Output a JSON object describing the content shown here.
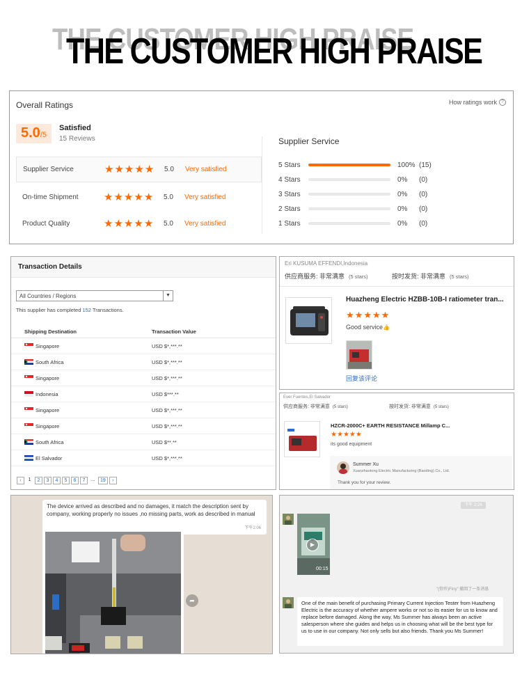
{
  "header": {
    "title": "THE CUSTOMER HIGH PRAISE"
  },
  "ratings": {
    "title": "Overall Ratings",
    "how_link": "How ratings work",
    "score": "5.0",
    "score_max": "/5",
    "level": "Satisfied",
    "reviews": "15 Reviews",
    "rows": [
      {
        "label": "Supplier Service",
        "stars": 5,
        "value": "5.0",
        "verdict": "Very satisfied"
      },
      {
        "label": "On-time Shipment",
        "stars": 5,
        "value": "5.0",
        "verdict": "Very satisfied"
      },
      {
        "label": "Product Quality",
        "stars": 5,
        "value": "5.0",
        "verdict": "Very satisfied"
      }
    ],
    "distribution_title": "Supplier Service",
    "distribution": [
      {
        "label": "5 Stars",
        "fraction": 1.0,
        "pct": "100%",
        "count": "(15)"
      },
      {
        "label": "4 Stars",
        "fraction": 0,
        "pct": "0%",
        "count": "(0)"
      },
      {
        "label": "3 Stars",
        "fraction": 0,
        "pct": "0%",
        "count": "(0)"
      },
      {
        "label": "2 Stars",
        "fraction": 0,
        "pct": "0%",
        "count": "(0)"
      },
      {
        "label": "1 Stars",
        "fraction": 0,
        "pct": "0%",
        "count": "(0)"
      }
    ],
    "accent": "#ff6a00"
  },
  "transactions": {
    "title": "Transaction Details",
    "select_value": "All Countries / Regions",
    "note_prefix": "This supplier has completed ",
    "note_count": "152",
    "note_suffix": " Transactions.",
    "col_destination": "Shipping Destination",
    "col_value": "Transaction Value",
    "rows": [
      {
        "country": "Singapore",
        "flag": "sg",
        "amount": "USD $*,***.**"
      },
      {
        "country": "South Africa",
        "flag": "za",
        "amount": "USD $*,***.**"
      },
      {
        "country": "Singapore",
        "flag": "sg",
        "amount": "USD $*,***.**"
      },
      {
        "country": "Indonesia",
        "flag": "id",
        "amount": "USD $***.**"
      },
      {
        "country": "Singapore",
        "flag": "sg",
        "amount": "USD $*,***.**"
      },
      {
        "country": "Singapore",
        "flag": "sg",
        "amount": "USD $*,***.**"
      },
      {
        "country": "South Africa",
        "flag": "za",
        "amount": "USD $**.**"
      },
      {
        "country": "El Salvador",
        "flag": "sv",
        "amount": "USD $*,***.**"
      }
    ],
    "pages": [
      "‹",
      "1",
      "2",
      "3",
      "4",
      "5",
      "6",
      "7",
      "...",
      "19",
      "›"
    ]
  },
  "review1": {
    "reviewer": "Eri KUSUMA EFFENDI,Indonesia",
    "meta1": "供应商服务: 非常满意",
    "meta1_stars": "(5 stars)",
    "meta2": "按时发货: 非常满意",
    "meta2_stars": "(5 stars)",
    "product": "Huazheng Electric HZBB-10B-I ratiometer tran...",
    "stars": 5,
    "comment": "Good service",
    "reply_link": "回复该评论"
  },
  "review2": {
    "reviewer": "Ever Fuentes,El Salvador",
    "meta1": "供应商服务: 非常满意",
    "meta1_stars": "(5 stars)",
    "meta2": "按时发货: 非常满意",
    "meta2_stars": "(5 stars)",
    "product": "HZCR-2000C+ EARTH RESISTANCE Millamp C...",
    "stars": 5,
    "comment": "its good equipment",
    "reply_name": "Summer Xu",
    "reply_company": "Xuanzhaotong Electric Manufacturing (Baoding) Co., Ltd.",
    "reply_text": "Thank you for your review."
  },
  "chat1": {
    "message": "The device arrived as described and no damages, it match the description  sent by company, working properly no issues ,no missing parts, work as described in manual",
    "time": "下午2:06"
  },
  "chat2": {
    "time_pill": "下午 2:26",
    "video_duration": "00:15",
    "recall_note": "\"(你作)Finy\" 撤回了一条消息",
    "message": "One of the main benefit of purchasing Primary Current Injection Tester from Huazheng Electric is the accuracy of whether ampere works or not so its easier for us to know and replace before damaged. Along the way, Ms Summer has always been an active salesperson where she guides and helps us in choosing what will be the best type for us to use in our company. Not only sells but also friends. Thank you Ms Summer!"
  }
}
